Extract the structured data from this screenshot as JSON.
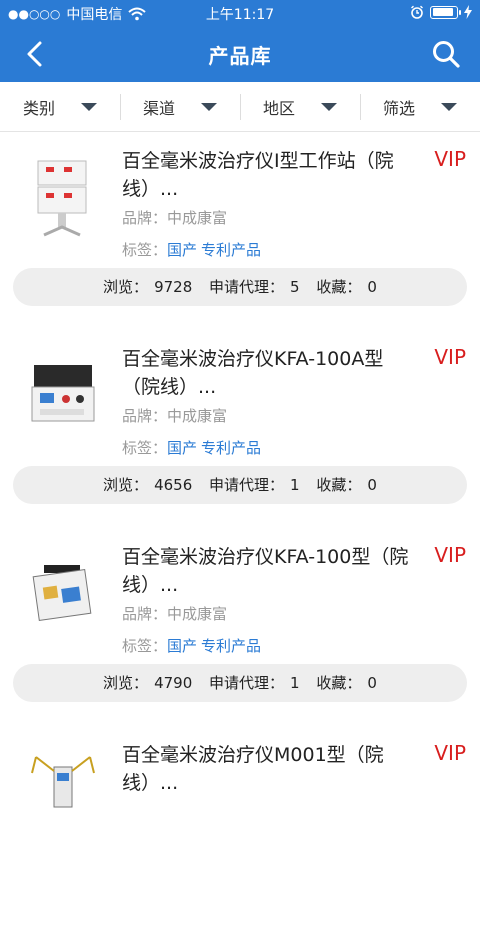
{
  "status_bar": {
    "signal": "●●○○○",
    "carrier": "中国电信",
    "time": "上午11:17",
    "battery_level": 0.9
  },
  "nav": {
    "title": "产品库",
    "back_icon": "back-chevron-icon",
    "search_icon": "search-icon"
  },
  "filters": [
    {
      "label": "类别"
    },
    {
      "label": "渠道"
    },
    {
      "label": "地区"
    },
    {
      "label": "筛选"
    }
  ],
  "labels": {
    "brand_prefix": "品牌：",
    "tags_prefix": "标签：",
    "views_prefix": "浏览：",
    "agency_prefix": "申请代理：",
    "favorites_prefix": "收藏："
  },
  "products": [
    {
      "name": "百全毫米波治疗仪I型工作站（院线）...",
      "vip": "VIP",
      "brand": "中成康富",
      "tags": [
        "国产",
        "专利产品"
      ],
      "views": "9728",
      "agency": "5",
      "favorites": "0"
    },
    {
      "name": "百全毫米波治疗仪KFA-100A型（院线）...",
      "vip": "VIP",
      "brand": "中成康富",
      "tags": [
        "国产",
        "专利产品"
      ],
      "views": "4656",
      "agency": "1",
      "favorites": "0"
    },
    {
      "name": "百全毫米波治疗仪KFA-100型（院线）...",
      "vip": "VIP",
      "brand": "中成康富",
      "tags": [
        "国产",
        "专利产品"
      ],
      "views": "4790",
      "agency": "1",
      "favorites": "0"
    },
    {
      "name": "百全毫米波治疗仪M001型（院线）...",
      "vip": "VIP"
    }
  ],
  "colors": {
    "primary": "#2b7bd4",
    "vip": "#d81e1e",
    "tag": "#2b7bd4"
  }
}
